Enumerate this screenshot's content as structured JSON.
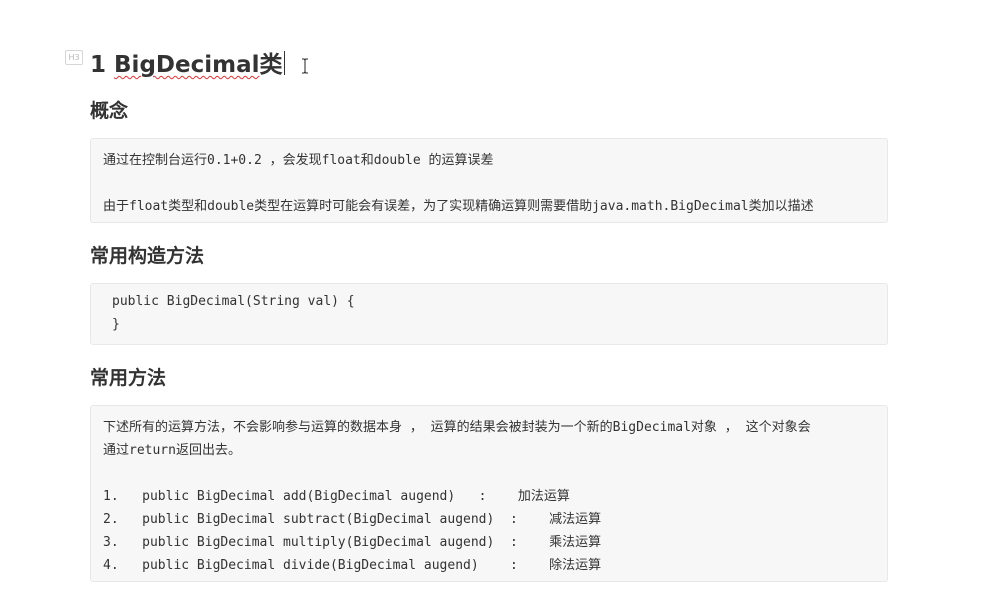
{
  "heading_marker": "H3",
  "title": {
    "number": "1",
    "text": "BigDecimal",
    "suffix": "类"
  },
  "sections": {
    "concept": {
      "heading": "概念",
      "lines": [
        "通过在控制台运行0.1+0.2 ，会发现float和double 的运算误差",
        "由于float类型和double类型在运算时可能会有误差，为了实现精确运算则需要借助java.math.BigDecimal类加以描述"
      ]
    },
    "constructor": {
      "heading": "常用构造方法",
      "lines": [
        "public BigDecimal(String val) {",
        "}"
      ]
    },
    "methods": {
      "heading": "常用方法",
      "lines": [
        "下述所有的运算方法，不会影响参与运算的数据本身 ， 运算的结果会被封装为一个新的BigDecimal对象 ， 这个对象会",
        "通过return返回出去。",
        "1.   public BigDecimal add(BigDecimal augend)   :    加法运算",
        "2.   public BigDecimal subtract(BigDecimal augend)  :    减法运算",
        "3.   public BigDecimal multiply(BigDecimal augend)  :    乘法运算",
        "4.   public BigDecimal divide(BigDecimal augend)    :    除法运算"
      ]
    }
  }
}
